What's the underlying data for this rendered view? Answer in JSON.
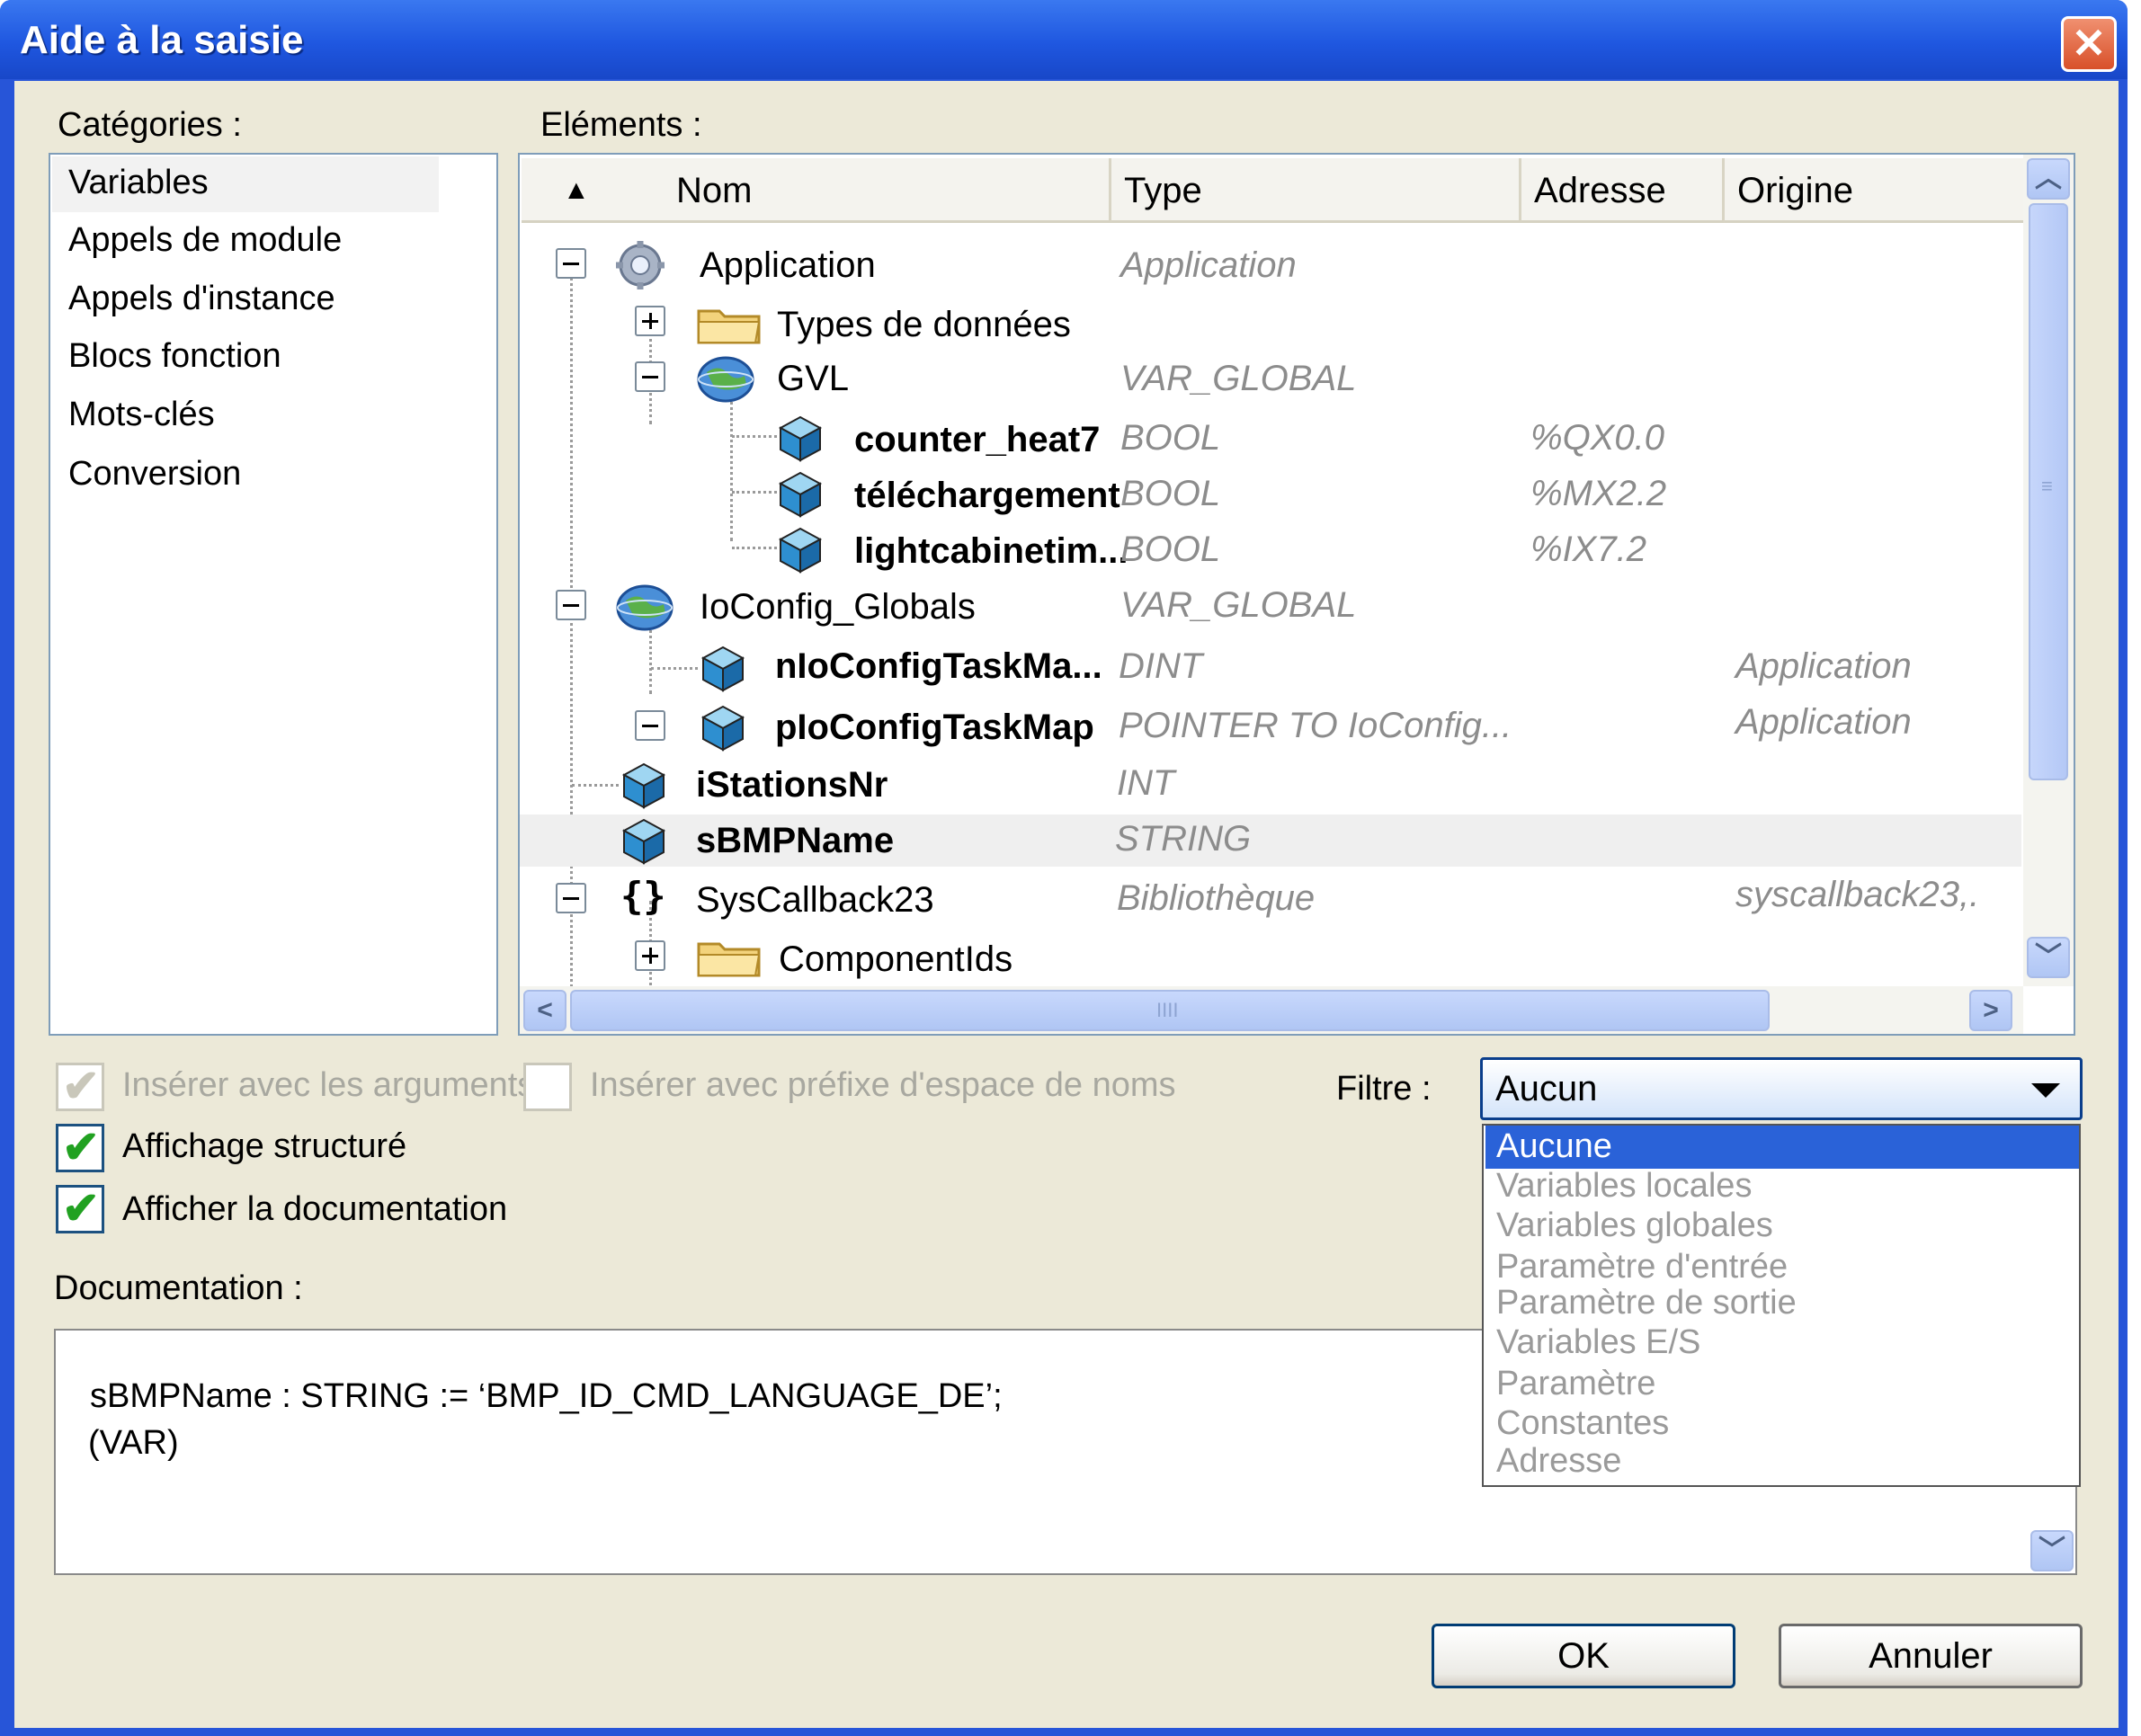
{
  "window": {
    "title": "Aide à la saisie",
    "close_label": "✕"
  },
  "categories": {
    "label": "Catégories :",
    "items": [
      "Variables",
      "Appels de module",
      "Appels d'instance",
      "Blocs fonction",
      "Mots-clés",
      "Conversion"
    ],
    "selected": "Variables"
  },
  "elements": {
    "label": "Eléments :",
    "columns": {
      "name": "Nom",
      "type": "Type",
      "address": "Adresse",
      "origin": "Origine"
    },
    "rows": [
      {
        "name": "Application",
        "type": "Application",
        "address": "",
        "origin": "",
        "icon": "gear-icon"
      },
      {
        "name": "Types de données",
        "type": "",
        "address": "",
        "origin": "",
        "icon": "folder-icon"
      },
      {
        "name": "GVL",
        "type": "VAR_GLOBAL",
        "address": "",
        "origin": "",
        "icon": "globe-icon"
      },
      {
        "name": "counter_heat7",
        "type": "BOOL",
        "address": "%QX0.0",
        "origin": "",
        "icon": "variable-icon"
      },
      {
        "name": "téléchargement",
        "type": "BOOL",
        "address": "%MX2.2",
        "origin": "",
        "icon": "variable-icon"
      },
      {
        "name": "lightcabinetim...",
        "type": "BOOL",
        "address": "%IX7.2",
        "origin": "",
        "icon": "variable-icon"
      },
      {
        "name": "IoConfig_Globals",
        "type": "VAR_GLOBAL",
        "address": "",
        "origin": "",
        "icon": "globe-icon"
      },
      {
        "name": "nIoConfigTaskMa...",
        "type": "DINT",
        "address": "",
        "origin": "Application",
        "icon": "variable-icon"
      },
      {
        "name": "pIoConfigTaskMap",
        "type": "POINTER TO IoConfig...",
        "address": "",
        "origin": "Application",
        "icon": "variable-icon"
      },
      {
        "name": "iStationsNr",
        "type": "INT",
        "address": "",
        "origin": "",
        "icon": "variable-icon"
      },
      {
        "name": "sBMPName",
        "type": "STRING",
        "address": "",
        "origin": "",
        "icon": "variable-icon"
      },
      {
        "name": "SysCallback23",
        "type": "Bibliothèque",
        "address": "",
        "origin": "syscallback23,.",
        "icon": "braces-icon"
      },
      {
        "name": "ComponentIds",
        "type": "",
        "address": "",
        "origin": "",
        "icon": "folder-icon"
      }
    ],
    "sort_arrow": "▲",
    "scroll_grip": "≡",
    "hscroll_grip": "IIII"
  },
  "options": {
    "insert_args": "Insérer avec les arguments",
    "insert_ns": "Insérer avec préfixe d'espace de noms",
    "structured": "Affichage structuré",
    "show_doc": "Afficher la documentation"
  },
  "filter": {
    "label": "Filtre :",
    "value": "Aucun",
    "options": [
      "Aucune",
      "Variables locales",
      "Variables globales",
      "Paramètre d'entrée",
      "Paramètre de sortie",
      "Variables E/S",
      "Paramètre",
      "Constantes",
      "Adresse"
    ]
  },
  "documentation": {
    "label": "Documentation :",
    "line1": "sBMPName : STRING := ‘BMP_ID_CMD_LANGUAGE_DE’;",
    "line2": "(VAR)"
  },
  "buttons": {
    "ok": "OK",
    "cancel": "Annuler"
  },
  "colors": {
    "title_bar": "#1f57e0",
    "dialog_bg": "#ece9d8",
    "selection": "#2a62d8",
    "type_text": "#8c8c8c"
  }
}
